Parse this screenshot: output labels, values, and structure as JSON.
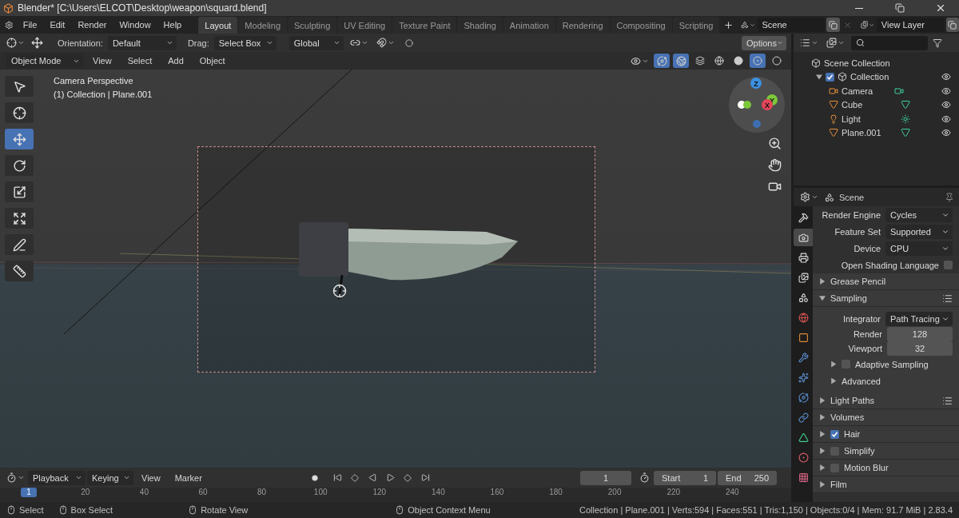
{
  "window": {
    "title": "Blender* [C:\\Users\\ELCOT\\Desktop\\weapon\\squard.blend]"
  },
  "menu": [
    "File",
    "Edit",
    "Render",
    "Window",
    "Help"
  ],
  "workspaces": [
    {
      "label": "Layout",
      "selected": true
    },
    {
      "label": "Modeling",
      "selected": false
    },
    {
      "label": "Sculpting",
      "selected": false
    },
    {
      "label": "UV Editing",
      "selected": false
    },
    {
      "label": "Texture Paint",
      "selected": false
    },
    {
      "label": "Shading",
      "selected": false
    },
    {
      "label": "Animation",
      "selected": false
    },
    {
      "label": "Rendering",
      "selected": false
    },
    {
      "label": "Compositing",
      "selected": false
    },
    {
      "label": "Scripting",
      "selected": false
    }
  ],
  "scene": {
    "name": "Scene"
  },
  "view_layer": {
    "name": "View Layer"
  },
  "tool_header": {
    "orientation_label": "Orientation:",
    "orientation": "Default",
    "drag_label": "Drag:",
    "drag": "Select Box",
    "transform": "Global",
    "options": "Options"
  },
  "viewport_header": {
    "mode": "Object Mode",
    "menus": [
      "View",
      "Select",
      "Add",
      "Object"
    ]
  },
  "viewport": {
    "title": "Camera Perspective",
    "subtitle": "(1) Collection | Plane.001",
    "axes": [
      {
        "label": "Z",
        "kind": "z"
      },
      {
        "label": "Y",
        "kind": "y"
      },
      {
        "label": "X",
        "kind": "x"
      }
    ]
  },
  "tools": [
    {
      "kind": "select",
      "selected": false
    },
    {
      "kind": "cursor",
      "selected": false
    },
    {
      "kind": "move",
      "selected": true
    },
    {
      "kind": "rotate",
      "selected": false
    },
    {
      "kind": "scale",
      "selected": false
    },
    {
      "kind": "transform",
      "selected": false
    },
    {
      "kind": "annotate",
      "selected": false
    },
    {
      "kind": "measure",
      "selected": false
    }
  ],
  "outliner": {
    "root": "Scene Collection",
    "items": [
      {
        "label": "Collection",
        "checked": true,
        "expanded": true,
        "children": [
          {
            "label": "Camera",
            "kind": "camera"
          },
          {
            "label": "Cube",
            "kind": "mesh"
          },
          {
            "label": "Light",
            "kind": "light"
          },
          {
            "label": "Plane.001",
            "kind": "mesh"
          }
        ]
      }
    ]
  },
  "properties": {
    "context": "Scene",
    "tabs": [
      {
        "kind": "tool",
        "selected": false
      },
      {
        "kind": "render",
        "selected": true
      },
      {
        "kind": "output",
        "selected": false
      },
      {
        "kind": "view_layer",
        "selected": false
      },
      {
        "kind": "scene",
        "selected": false
      },
      {
        "kind": "world",
        "selected": false
      },
      {
        "kind": "object",
        "selected": false
      },
      {
        "kind": "modifiers",
        "selected": false
      },
      {
        "kind": "particles",
        "selected": false
      },
      {
        "kind": "physics",
        "selected": false
      },
      {
        "kind": "constraints",
        "selected": false
      },
      {
        "kind": "data",
        "selected": false
      },
      {
        "kind": "material",
        "selected": false
      },
      {
        "kind": "texture",
        "selected": false
      }
    ],
    "fields": [
      {
        "label": "Render Engine",
        "kind": "dropdown",
        "value": "Cycles"
      },
      {
        "label": "Feature Set",
        "kind": "dropdown",
        "value": "Supported"
      },
      {
        "label": "Device",
        "kind": "dropdown",
        "value": "CPU"
      },
      {
        "label": "Open Shading Language",
        "kind": "checkbox",
        "checked": false
      }
    ],
    "panels": [
      {
        "label": "Grease Pencil",
        "expanded": false
      },
      {
        "label": "Sampling",
        "expanded": true,
        "presets": true,
        "fields": [
          {
            "label": "Integrator",
            "kind": "dropdown",
            "value": "Path Tracing"
          },
          {
            "label": "Render",
            "kind": "number",
            "value": "128"
          },
          {
            "label": "Viewport",
            "kind": "number",
            "value": "32"
          }
        ],
        "subpanels": [
          {
            "label": "Adaptive Sampling",
            "expanded": false,
            "checked": false
          },
          {
            "label": "Advanced",
            "expanded": false
          }
        ]
      },
      {
        "label": "Light Paths",
        "expanded": false,
        "presets": true
      },
      {
        "label": "Volumes",
        "expanded": false
      },
      {
        "label": "Hair",
        "expanded": false,
        "checked": true
      },
      {
        "label": "Simplify",
        "expanded": false,
        "checked": false
      },
      {
        "label": "Motion Blur",
        "expanded": false,
        "checked": false
      },
      {
        "label": "Film",
        "expanded": false
      }
    ]
  },
  "timeline": {
    "menus": [
      {
        "label": "Playback",
        "dropdown": true
      },
      {
        "label": "Keying",
        "dropdown": true
      },
      {
        "label": "View",
        "dropdown": false
      },
      {
        "label": "Marker",
        "dropdown": false
      }
    ],
    "current_frame": "1",
    "start_label": "Start",
    "start": "1",
    "end_label": "End",
    "end": "250",
    "playhead": "1",
    "ruler": [
      "20",
      "40",
      "60",
      "80",
      "100",
      "120",
      "140",
      "160",
      "180",
      "200",
      "220",
      "240"
    ]
  },
  "status_bar": {
    "hints": [
      "Select",
      "Box Select",
      "Rotate View",
      "Object Context Menu"
    ],
    "stats": "Collection | Plane.001 | Verts:594 | Faces:551 | Tris:1,150 | Objects:0/4 | Mem: 91.7 MiB | 2.83.4"
  }
}
